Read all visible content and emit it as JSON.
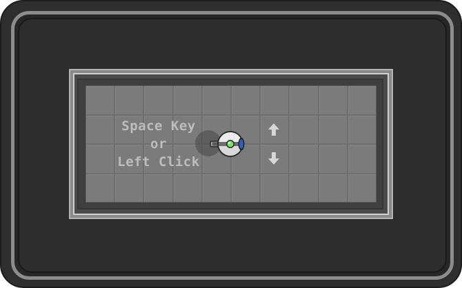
{
  "hint": {
    "line1": "Space Key",
    "line2": "or",
    "line3": "Left Click"
  },
  "grid": {
    "columns": 10,
    "rows": 4
  },
  "icons": {
    "player": "round-robot-player-icon",
    "up": "arrow-up-icon",
    "down": "arrow-down-icon"
  },
  "colors": {
    "frame": "#2e2e2e",
    "ring": "#8c8c8c",
    "grid_cell": "#7b7b7b",
    "hint_text": "#bdbdbd",
    "player_core": "#7be06a",
    "player_thruster": "#2f5fc0"
  }
}
